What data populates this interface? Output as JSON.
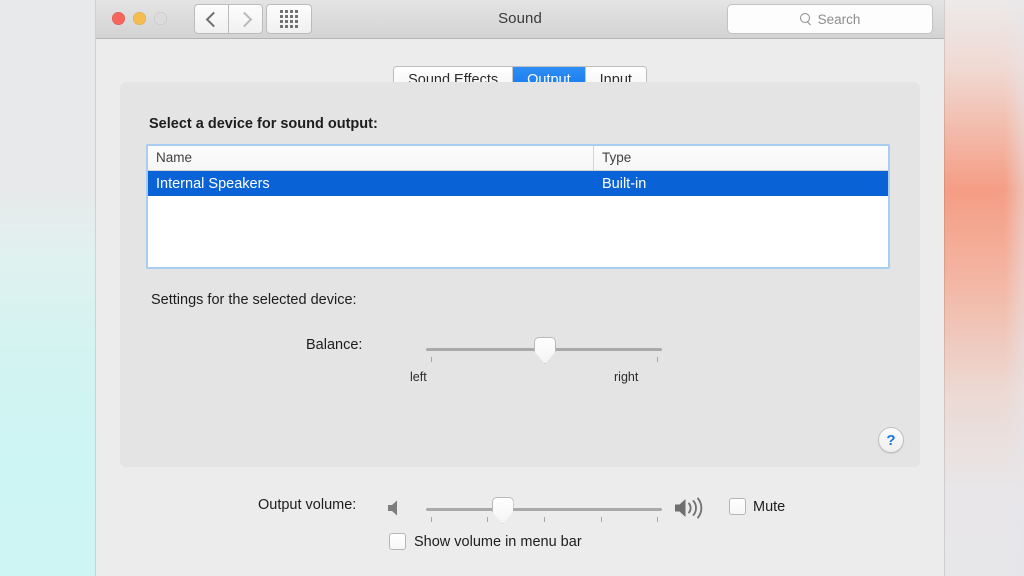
{
  "window": {
    "title": "Sound",
    "traffic_lights": [
      "close",
      "minimize",
      "zoom"
    ],
    "nav": {
      "back": "back-icon",
      "forward": "forward-icon",
      "grid": "show-all-icon"
    },
    "search": {
      "placeholder": "Search",
      "value": "",
      "icon": "search-icon"
    }
  },
  "tabs": [
    {
      "label": "Sound Effects",
      "active": false
    },
    {
      "label": "Output",
      "active": true
    },
    {
      "label": "Input",
      "active": false
    }
  ],
  "panel": {
    "select_label": "Select a device for sound output:",
    "settings_label": "Settings for the selected device:",
    "table": {
      "columns": [
        "Name",
        "Type"
      ],
      "rows": [
        {
          "name": "Internal Speakers",
          "type": "Built-in",
          "selected": true
        }
      ]
    },
    "balance": {
      "label": "Balance:",
      "left_label": "left",
      "right_label": "right",
      "value_percent": 50,
      "ticks_percent": [
        2,
        50,
        98
      ]
    },
    "help_button": {
      "label": "?",
      "icon": "help-icon"
    }
  },
  "bottom": {
    "output_volume_label": "Output volume:",
    "volume_low_icon": "speaker-low-icon",
    "volume_high_icon": "speaker-high-icon",
    "volume_percent": 32,
    "volume_ticks_percent": [
      2,
      26,
      50,
      74,
      98
    ],
    "mute": {
      "label": "Mute",
      "checked": false
    },
    "show_volume": {
      "label": "Show volume in menu bar",
      "checked": false
    }
  },
  "colors": {
    "accent_blue": "#0a63d6",
    "tab_active_blue": "#1277ef",
    "help_blue": "#1676e0",
    "panel_gray": "#e4e4e4",
    "window_gray": "#ececec",
    "focus_ring": "#a8cdf0"
  }
}
